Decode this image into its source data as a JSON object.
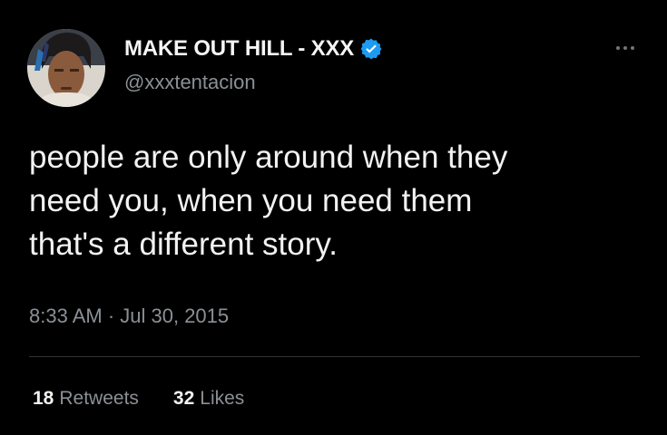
{
  "tweet": {
    "display_name": "MAKE OUT HILL - XXX",
    "handle": "@xxxtentacion",
    "text_lines": [
      "people are only around when they",
      "need you, when you need them",
      "that's a different story."
    ],
    "timestamp": "8:33 AM · Jul 30, 2015",
    "retweets_count": "18",
    "retweets_label": "Retweets",
    "likes_count": "32",
    "likes_label": "Likes",
    "verified": true
  },
  "icons": {
    "verified": "verified-badge-icon",
    "more": "more-options-icon"
  },
  "colors": {
    "background": "#000000",
    "text_primary": "#e7e9ea",
    "text_secondary": "#8b9096",
    "verified_blue": "#1d9bf0",
    "divider": "#2f3336"
  }
}
